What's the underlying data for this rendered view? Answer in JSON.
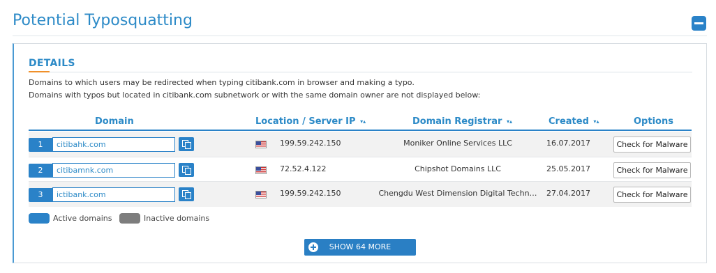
{
  "page_title": "Potential Typosquatting",
  "section": {
    "title": "DETAILS",
    "description_1": "Domains to which users may be redirected when typing citibank.com in browser and making a typo.",
    "description_2": "Domains with typos but located in citibank.com subnetwork or with the same domain owner are not displayed below:"
  },
  "table": {
    "headers": {
      "domain": "Domain",
      "location": "Location / Server IP",
      "registrar": "Domain Registrar",
      "created": "Created",
      "options": "Options"
    },
    "sort_icon": "▾▴",
    "rows": [
      {
        "num": "1",
        "domain": "citibahk.com",
        "flag": "us-flag-icon",
        "ip": "199.59.242.150",
        "registrar": "Moniker Online Services LLC",
        "created": "16.07.2017",
        "action": "Check for Malware"
      },
      {
        "num": "2",
        "domain": "citibamnk.com",
        "flag": "us-flag-icon",
        "ip": "72.52.4.122",
        "registrar": "Chipshot Domains LLC",
        "created": "25.05.2017",
        "action": "Check for Malware"
      },
      {
        "num": "3",
        "domain": "ictibank.com",
        "flag": "us-flag-icon",
        "ip": "199.59.242.150",
        "registrar": "Chengdu West Dimension Digital Techn…",
        "created": "27.04.2017",
        "action": "Check for Malware"
      }
    ]
  },
  "legend": {
    "active": "Active domains",
    "inactive": "Inactive domains"
  },
  "show_more": "SHOW 64 MORE",
  "colors": {
    "accent": "#2a82c8",
    "title": "#2c8ac7",
    "underline": "#f0902a",
    "inactive": "#7d7d7d"
  }
}
